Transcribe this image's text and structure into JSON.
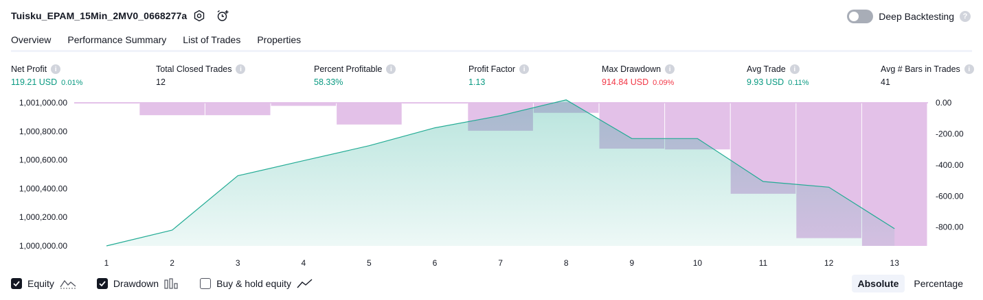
{
  "header": {
    "strategy_name": "Tuisku_EPAM_15Min_2MV0_0668277a",
    "deep_backtesting_label": "Deep Backtesting",
    "help_glyph": "?"
  },
  "tabs": [
    {
      "label": "Overview",
      "active": true
    },
    {
      "label": "Performance Summary",
      "active": false
    },
    {
      "label": "List of Trades",
      "active": false
    },
    {
      "label": "Properties",
      "active": false
    }
  ],
  "metrics": [
    {
      "label": "Net Profit",
      "value": "119.21 USD",
      "sub": "0.01%",
      "tone": "green"
    },
    {
      "label": "Total Closed Trades",
      "value": "12",
      "sub": "",
      "tone": "dark"
    },
    {
      "label": "Percent Profitable",
      "value": "58.33%",
      "sub": "",
      "tone": "green"
    },
    {
      "label": "Profit Factor",
      "value": "1.13",
      "sub": "",
      "tone": "green"
    },
    {
      "label": "Max Drawdown",
      "value": "914.84 USD",
      "sub": "0.09%",
      "tone": "red"
    },
    {
      "label": "Avg Trade",
      "value": "9.93 USD",
      "sub": "0.11%",
      "tone": "green"
    },
    {
      "label": "Avg # Bars in Trades",
      "value": "41",
      "sub": "",
      "tone": "dark"
    }
  ],
  "info_glyph": "i",
  "chart_data": {
    "type": "area",
    "x": [
      1,
      2,
      3,
      4,
      5,
      6,
      7,
      8,
      9,
      10,
      11,
      12,
      13
    ],
    "left_axis_ticks": [
      "1,001,000.00",
      "1,000,800.00",
      "1,000,600.00",
      "1,000,400.00",
      "1,000,200.00",
      "1,000,000.00"
    ],
    "right_axis_ticks": [
      "0.00",
      "-200.00",
      "-400.00",
      "-600.00",
      "-800.00"
    ],
    "left_ylim": [
      1000000,
      1001000
    ],
    "right_ylim": [
      -920,
      0
    ],
    "series": [
      {
        "name": "Equity",
        "kind": "area-line",
        "axis": "left",
        "values": [
          1000000,
          1000110,
          1000490,
          1000595,
          1000700,
          1000825,
          1000910,
          1001020,
          1000750,
          1000750,
          1000450,
          1000410,
          1000120
        ],
        "color": "#22ab94"
      },
      {
        "name": "Drawdown",
        "kind": "bar",
        "axis": "right",
        "values": [
          -5,
          -80,
          -80,
          -20,
          -140,
          -5,
          -180,
          -65,
          -295,
          -300,
          -585,
          -870,
          -920
        ],
        "color": "#ce93d8"
      }
    ],
    "grid": false
  },
  "legend": [
    {
      "label": "Equity",
      "checked": true
    },
    {
      "label": "Drawdown",
      "checked": true
    },
    {
      "label": "Buy & hold equity",
      "checked": false
    }
  ],
  "modes": [
    {
      "label": "Absolute",
      "active": true
    },
    {
      "label": "Percentage",
      "active": false
    }
  ]
}
